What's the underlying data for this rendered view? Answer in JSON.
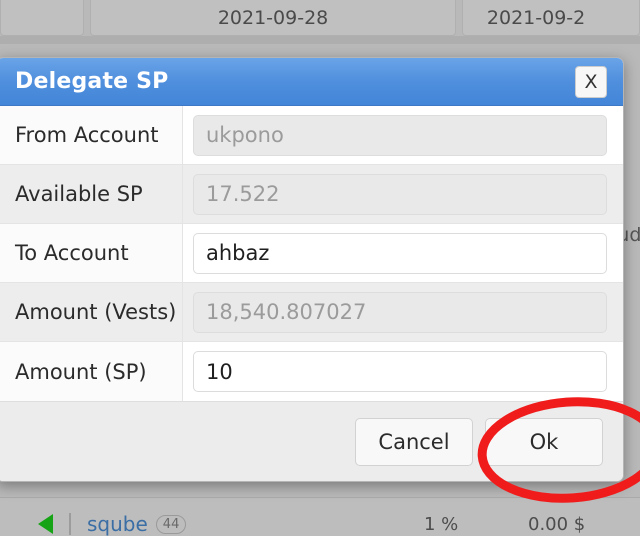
{
  "background": {
    "date_cells": [
      "",
      "2021-09-28",
      "2021-09-2"
    ],
    "right_text_fragment": "lud",
    "bottom_row": {
      "expand_icon": "green-triangle-icon",
      "account_name": "sqube",
      "badge_count": "44",
      "percent": "1 %",
      "amount": "0.00 $"
    }
  },
  "modal": {
    "title": "Delegate SP",
    "close_label": "X",
    "fields": [
      {
        "label": "From Account",
        "value": "ukpono",
        "disabled": true,
        "name": "from-account"
      },
      {
        "label": "Available SP",
        "value": "17.522",
        "disabled": true,
        "name": "available-sp"
      },
      {
        "label": "To Account",
        "value": "ahbaz",
        "disabled": false,
        "name": "to-account"
      },
      {
        "label": "Amount (Vests)",
        "value": "18,540.807027",
        "disabled": true,
        "name": "amount-vests"
      },
      {
        "label": "Amount (SP)",
        "value": "10",
        "disabled": false,
        "name": "amount-sp"
      }
    ],
    "footer": {
      "cancel_label": "Cancel",
      "ok_label": "Ok"
    }
  },
  "annotation": {
    "type": "ellipse-highlight",
    "color": "#f01c1c",
    "target": "ok-button"
  },
  "colors": {
    "titlebar_accent": "#4f8fdd",
    "annotation_red": "#f01c1c",
    "link_blue": "#3a6ea5",
    "triangle_green": "#16a416"
  }
}
